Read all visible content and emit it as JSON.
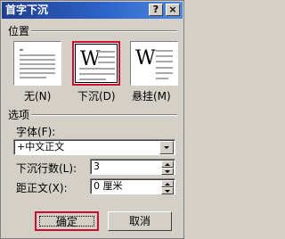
{
  "window": {
    "title": "首字下沉",
    "help_glyph": "?",
    "close_glyph": "×"
  },
  "position": {
    "section_label": "位置",
    "options": [
      {
        "label": "无(N)",
        "glyph": "",
        "selected": false
      },
      {
        "label": "下沉(D)",
        "glyph": "W",
        "selected": true
      },
      {
        "label": "悬挂(M)",
        "glyph": "W",
        "selected": false
      }
    ]
  },
  "options_section": {
    "section_label": "选项",
    "font_label": "字体(F):",
    "font_value": "+中文正文",
    "lines_label": "下沉行数(L):",
    "lines_value": "3",
    "distance_label": "距正文(X):",
    "distance_value": "0 厘米"
  },
  "buttons": {
    "ok_label": "确定",
    "cancel_label": "取消"
  },
  "colors": {
    "title_bar": "#2d62c8",
    "highlight": "#c8102e",
    "dialog_bg": "#d4d0c8"
  }
}
